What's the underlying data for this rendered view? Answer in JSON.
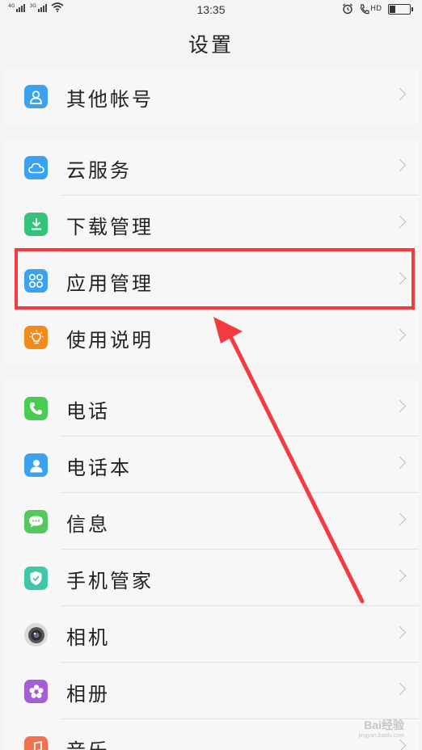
{
  "status_bar": {
    "signal1_label": "4G",
    "signal2_label": "3G",
    "time": "13:35",
    "hd_label": "HD"
  },
  "title": "设置",
  "sections": [
    {
      "items": [
        {
          "label": "其他帐号",
          "icon": "account-icon",
          "color": "#3aa2f0"
        }
      ]
    },
    {
      "items": [
        {
          "label": "云服务",
          "icon": "cloud-icon",
          "color": "#3aa2f0"
        },
        {
          "label": "下载管理",
          "icon": "download-icon",
          "color": "#34c37a"
        },
        {
          "label": "应用管理",
          "icon": "apps-icon",
          "color": "#3aa2f0"
        },
        {
          "label": "使用说明",
          "icon": "lightbulb-icon",
          "color": "#f28b1c"
        }
      ]
    },
    {
      "items": [
        {
          "label": "电话",
          "icon": "phone-icon",
          "color": "#48cc52"
        },
        {
          "label": "电话本",
          "icon": "contacts-icon",
          "color": "#3aa2f0"
        },
        {
          "label": "信息",
          "icon": "message-icon",
          "color": "#52c95c"
        },
        {
          "label": "手机管家",
          "icon": "shield-icon",
          "color": "#3ec7a8"
        },
        {
          "label": "相机",
          "icon": "camera-icon",
          "color": "#555555"
        },
        {
          "label": "相册",
          "icon": "gallery-icon",
          "color": "#a45fd8"
        },
        {
          "label": "音乐",
          "icon": "music-icon",
          "color": "#f2714e"
        }
      ]
    }
  ],
  "highlight_color": "#f53b40",
  "watermark": {
    "text": "Bai经验",
    "sub": "jingyan.baidu.com"
  }
}
